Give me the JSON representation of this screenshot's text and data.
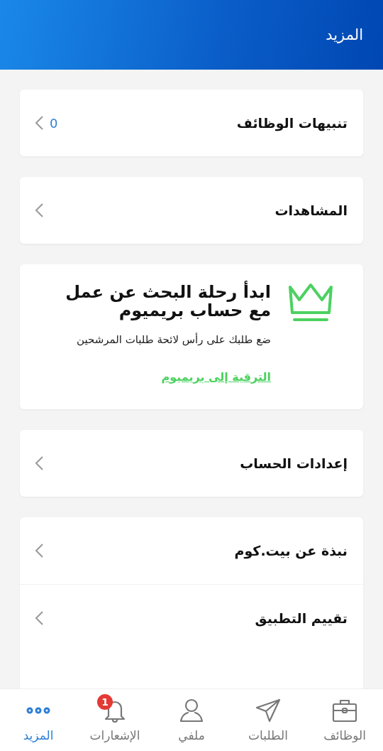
{
  "header": {
    "title": "المزيد"
  },
  "sections": [
    {
      "kind": "rows",
      "rows": [
        {
          "label": "تنبيهات الوظائف",
          "value": "0"
        }
      ]
    },
    {
      "kind": "rows",
      "rows": [
        {
          "label": "المشاهدات"
        }
      ]
    },
    {
      "kind": "premium",
      "title": "ابدأ رحلة البحث عن عمل مع حساب بريميوم",
      "text": "ضع طلبك على رأس لائحة طلبات المرشحين",
      "link": "الترقية إلى بريميوم"
    },
    {
      "kind": "rows",
      "rows": [
        {
          "label": "إعدادات الحساب"
        }
      ]
    },
    {
      "kind": "rows",
      "rows": [
        {
          "label": "نبذة عن بيت.كوم"
        },
        {
          "label": "تقييم التطبيق"
        }
      ]
    }
  ],
  "tabs": [
    {
      "label": "الوظائف",
      "selected": false
    },
    {
      "label": "الطلبات",
      "selected": false
    },
    {
      "label": "ملفي",
      "selected": false
    },
    {
      "label": "الإشعارات",
      "selected": false,
      "badge": "1"
    },
    {
      "label": "المزيد",
      "selected": true
    }
  ]
}
